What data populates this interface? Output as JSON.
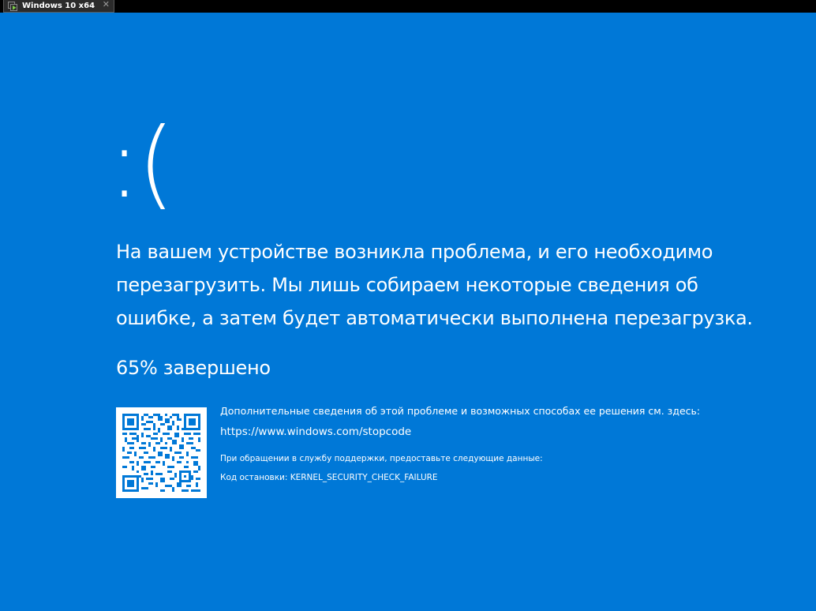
{
  "vm_window": {
    "tab_title": "Windows 10 x64",
    "tab_icon": "vm-play-icon",
    "close_icon": "close-icon"
  },
  "bsod": {
    "background_color": "#0078d7",
    "face": ":(",
    "message_lines": [
      "На вашем устройстве возникла проблема, и его необходимо",
      "перезагрузить. Мы лишь собираем некоторые сведения об",
      "ошибке, а затем будет автоматически выполнена перезагрузка."
    ],
    "progress_percent": 65,
    "progress_text": "65% завершено",
    "info_text": "Дополнительные сведения об этой проблеме и возможных способах ее решения см. здесь:",
    "info_url": "https://www.windows.com/stopcode",
    "support_text": "При обращении в службу поддержки, предоставьте следующие данные:",
    "stop_code_text": "Код остановки: KERNEL_SECURITY_CHECK_FAILURE"
  }
}
